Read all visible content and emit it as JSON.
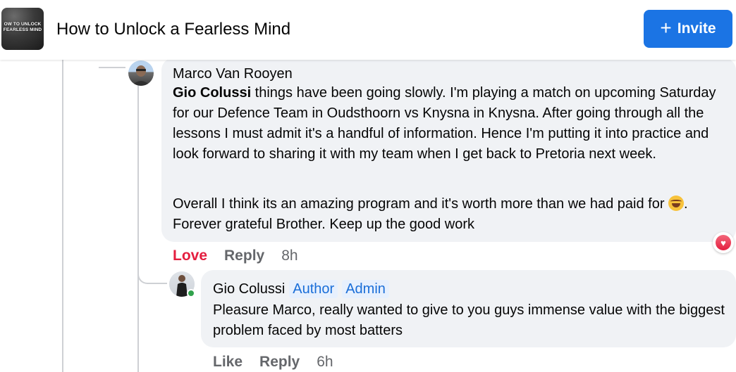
{
  "header": {
    "thumbnail_text": "OW TO UNLOCK FEARLESS MIND",
    "title": "How to Unlock a Fearless Mind",
    "invite_label": "Invite"
  },
  "comments": [
    {
      "author": "Marco Van Rooyen",
      "mention": "Gio Colussi",
      "paragraph1": " things have been going slowly. I'm playing a match on upcoming Saturday for our Defence Team in Oudsthoorn vs Knysna in Knysna. After going through all the lessons I must admit it's a handful of information. Hence I'm putting it into practice and look forward to sharing it with my team when I get back to Pretoria next week.",
      "paragraph2_before_emoji": "Overall I think its an amazing program and it's worth more than we had paid for ",
      "paragraph2_after_emoji": ". Forever grateful Brother. Keep up the good work",
      "reaction_label": "Love",
      "reply_label": "Reply",
      "time": "8h",
      "reaction_icon": "heart-icon"
    },
    {
      "author": "Gio Colussi",
      "badges": [
        "Author",
        "Admin"
      ],
      "text": "Pleasure Marco, really wanted to give to you guys immense value with the biggest problem faced by most batters",
      "reaction_label": "Like",
      "reply_label": "Reply",
      "time": "6h"
    }
  ],
  "colors": {
    "accent": "#1b74e4",
    "love": "#e41e3f",
    "bubble": "#f0f2f5",
    "online": "#31a24c"
  }
}
